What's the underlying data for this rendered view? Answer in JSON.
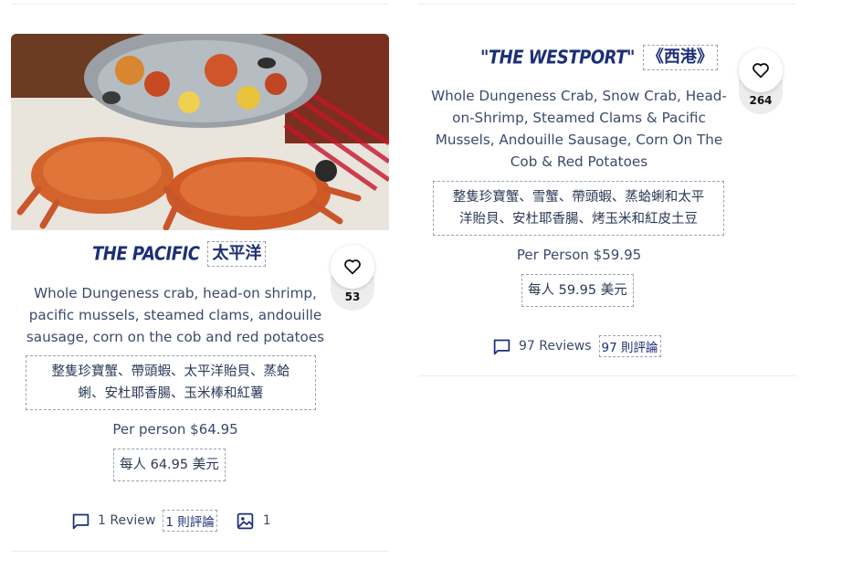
{
  "cards": [
    {
      "title_en": "THE PACIFIC",
      "title_zh": "太平洋",
      "description": [
        "Whole Dungeness crab, head-on shrimp,",
        "pacific mussels, steamed clams, andouille",
        "sausage, corn on the cob and red potatoes"
      ],
      "description_zh": [
        "整隻珍寶蟹、帶頭蝦、太平洋貽貝、蒸蛤",
        "蜊、安杜耶香腸、玉米棒和紅薯"
      ],
      "price": "Per person $64.95",
      "price_zh": "每人 64.95 美元",
      "likes": "53",
      "reviews": "1 Review",
      "reviews_zh": "1 則評論",
      "photos": "1",
      "icons": {
        "favorite": "heart-outline-icon",
        "reviews": "comment-icon",
        "photos": "image-icon"
      }
    },
    {
      "title_en": "\"THE WESTPORT\"",
      "title_zh": "《西港》",
      "description": [
        "Whole Dungeness Crab, Snow Crab, Head-",
        "on-Shrimp, Steamed Clams & Pacific",
        "Mussels, Andouille Sausage, Corn On The",
        "Cob & Red Potatoes"
      ],
      "description_zh": [
        "整隻珍寶蟹、雪蟹、帶頭蝦、蒸蛤蜊和太平",
        "洋貽貝、安杜耶香腸、烤玉米和紅皮土豆"
      ],
      "price": "Per Person $59.95",
      "price_zh": "每人 59.95 美元",
      "likes": "264",
      "reviews": "97 Reviews",
      "reviews_zh": "97 則評論",
      "icons": {
        "favorite": "heart-outline-icon",
        "reviews": "comment-icon"
      }
    }
  ],
  "colors": {
    "title": "#1d2f77",
    "text": "#3b4a6b",
    "dashed_border": "#9aa3b5",
    "like_count_bg": "#ededed"
  }
}
